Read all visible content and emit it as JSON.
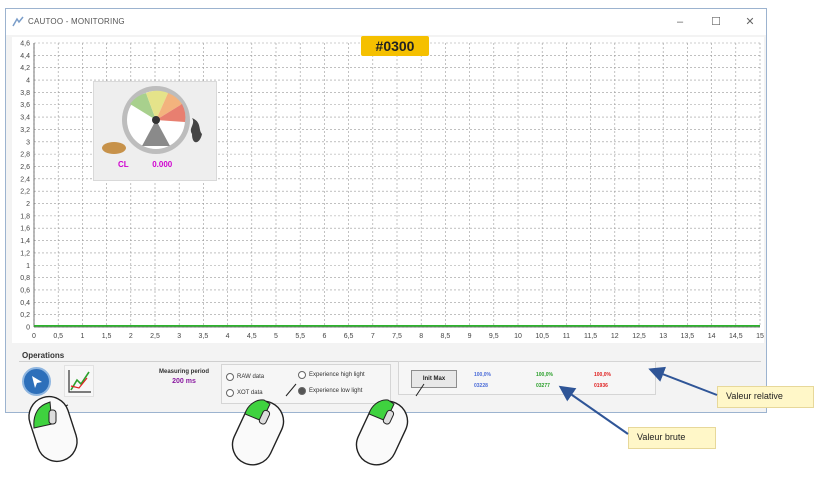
{
  "window": {
    "title": "CAUTOO - MONITORING",
    "controls": {
      "minimize": "–",
      "maximize": "☐",
      "close": "✕"
    }
  },
  "badge": "#0300",
  "gauge": {
    "label": "CL",
    "value": "0.000"
  },
  "chart_data": {
    "type": "line",
    "title": "",
    "xlabel": "",
    "ylabel": "",
    "xlim": [
      0,
      15
    ],
    "ylim": [
      0,
      4.6
    ],
    "x_ticks": [
      "0",
      "0,5",
      "1",
      "1,5",
      "2",
      "2,5",
      "3",
      "3,5",
      "4",
      "4,5",
      "5",
      "5,5",
      "6",
      "6,5",
      "7",
      "7,5",
      "8",
      "8,5",
      "9",
      "9,5",
      "10",
      "10,5",
      "11",
      "11,5",
      "12",
      "12,5",
      "13",
      "13,5",
      "14",
      "14,5",
      "15"
    ],
    "y_ticks": [
      "0",
      "0,2",
      "0,4",
      "0,6",
      "0,8",
      "1",
      "1,2",
      "1,4",
      "1,6",
      "1,8",
      "2",
      "2,2",
      "2,4",
      "2,6",
      "2,8",
      "3",
      "3,2",
      "3,4",
      "3,6",
      "3,8",
      "4",
      "4,2",
      "4,4",
      "4,6"
    ],
    "grid": true,
    "series": [
      {
        "color": "#2bb52b",
        "x": [
          0,
          15
        ],
        "y": [
          0.02,
          0.02
        ]
      }
    ]
  },
  "operations": {
    "title": "Operations",
    "measuring_period_label": "Measuring period",
    "measuring_period_value": "200 ms",
    "radios": {
      "raw": "RAW data",
      "xot": "XOT data",
      "high": "Experience high light",
      "low": "Experience low light"
    },
    "init_button": "Init Max",
    "values": {
      "rel_blue": "100,0%",
      "raw_blue": "03228",
      "rel_green": "100,0%",
      "raw_green": "03277",
      "rel_red": "100,0%",
      "raw_red": "01936"
    },
    "colors": {
      "blue": "#4a6bd8",
      "green": "#2ca02c",
      "red": "#e02020",
      "period": "#8a1aa0"
    }
  },
  "callouts": {
    "relative": "Valeur relative",
    "raw": "Valeur brute"
  }
}
